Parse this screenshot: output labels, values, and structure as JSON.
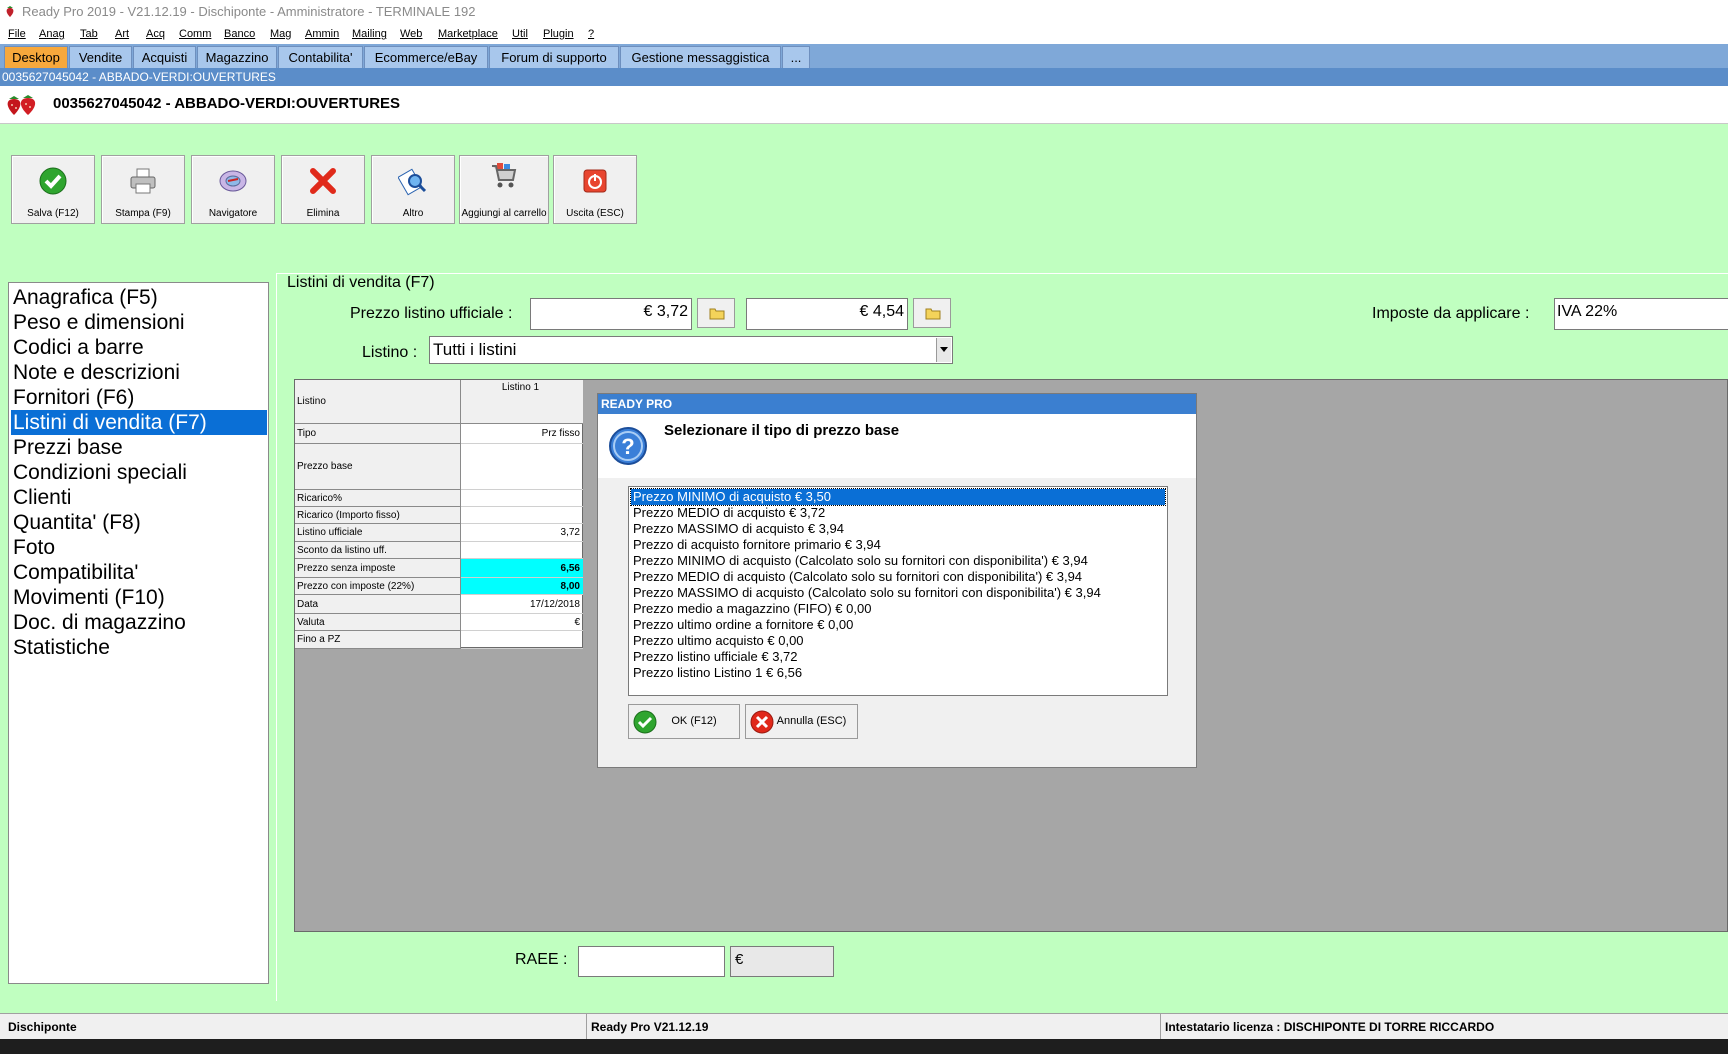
{
  "window": {
    "title": "Ready Pro 2019 - V21.12.19 - Dischiponte - Amministratore - TERMINALE 192"
  },
  "menu": [
    "File",
    "Anag",
    "Tab",
    "Art",
    "Acq",
    "Comm",
    "Banco",
    "Mag",
    "Ammin",
    "Mailing",
    "Web",
    "Marketplace",
    "Util",
    "Plugin",
    "?"
  ],
  "tabs": [
    {
      "label": "Desktop",
      "active": true
    },
    {
      "label": "Vendite"
    },
    {
      "label": "Acquisti"
    },
    {
      "label": "Magazzino"
    },
    {
      "label": "Contabilita'"
    },
    {
      "label": "Ecommerce/eBay"
    },
    {
      "label": "Forum di supporto"
    },
    {
      "label": "Gestione messaggistica"
    },
    {
      "label": "..."
    }
  ],
  "header": {
    "subtitle": "0035627045042 - ABBADO-VERDI:OUVERTURES",
    "title": "0035627045042 - ABBADO-VERDI:OUVERTURES"
  },
  "toolbar": [
    {
      "label": "Salva (F12)",
      "icon": "check-icon"
    },
    {
      "label": "Stampa (F9)",
      "icon": "printer-icon"
    },
    {
      "label": "Navigatore",
      "icon": "navigator-icon"
    },
    {
      "label": "Elimina",
      "icon": "delete-x-icon"
    },
    {
      "label": "Altro",
      "icon": "search-doc-icon"
    },
    {
      "label": "Aggiungi al carrello",
      "icon": "cart-icon"
    },
    {
      "label": "Uscita (ESC)",
      "icon": "power-icon"
    }
  ],
  "nav": {
    "items": [
      "Anagrafica (F5)",
      "Peso e dimensioni",
      "Codici a barre",
      "Note e descrizioni",
      "Fornitori (F6)",
      "Listini di vendita (F7)",
      "Prezzi base",
      "Condizioni speciali",
      "Clienti",
      "Quantita' (F8)",
      "Foto",
      "Compatibilita'",
      "Movimenti (F10)",
      "Doc. di magazzino",
      "Statistiche"
    ],
    "selected_index": 5
  },
  "panel": {
    "group_title": "Listini di vendita (F7)",
    "price_label": "Prezzo listino ufficiale :",
    "price1": "€ 3,72",
    "price2": "€ 4,54",
    "tax_label": "Imposte da applicare :",
    "tax_value": "IVA 22%",
    "listino_label": "Listino :",
    "listino_value": "Tutti i listini",
    "raee_label": "RAEE :",
    "raee_value": "",
    "raee_currency": "€"
  },
  "grid": {
    "header_key": "Listino",
    "header_col": "Listino 1",
    "rows": [
      {
        "k": "Tipo",
        "v": "Prz fisso"
      },
      {
        "k": "Prezzo base",
        "v": ""
      },
      {
        "k": "Ricarico%",
        "v": ""
      },
      {
        "k": "Ricarico (Importo fisso)",
        "v": ""
      },
      {
        "k": "Listino ufficiale",
        "v": "3,72"
      },
      {
        "k": "Sconto da listino uff.",
        "v": ""
      },
      {
        "k": "Prezzo senza imposte",
        "v": "6,56",
        "highlight": true
      },
      {
        "k": "Prezzo con imposte (22%)",
        "v": "8,00",
        "highlight": true
      },
      {
        "k": "Data",
        "v": "17/12/2018"
      },
      {
        "k": "Valuta",
        "v": "€"
      },
      {
        "k": "Fino a PZ",
        "v": ""
      }
    ]
  },
  "dialog": {
    "title": "READY PRO",
    "message": "Selezionare il tipo di prezzo base",
    "options": [
      "Prezzo MINIMO di acquisto € 3,50",
      "Prezzo MEDIO di acquisto € 3,72",
      "Prezzo MASSIMO di acquisto € 3,94",
      "Prezzo di acquisto fornitore primario € 3,94",
      "Prezzo MINIMO di acquisto (Calcolato solo su fornitori con disponibilita') € 3,94",
      "Prezzo MEDIO di acquisto (Calcolato solo su fornitori con disponibilita') € 3,94",
      "Prezzo MASSIMO di acquisto (Calcolato solo su fornitori con disponibilita') € 3,94",
      "Prezzo medio a magazzino (FIFO) € 0,00",
      "Prezzo ultimo ordine a fornitore € 0,00",
      "Prezzo ultimo acquisto € 0,00",
      "Prezzo listino ufficiale € 3,72",
      "Prezzo listino Listino 1 € 6,56"
    ],
    "selected_index": 0,
    "ok_label": "OK (F12)",
    "cancel_label": "Annulla (ESC)"
  },
  "status": {
    "left": "Dischiponte",
    "center": "Ready Pro V21.12.19",
    "right": "Intestatario licenza : DISCHIPONTE DI TORRE RICCARDO"
  },
  "colors": {
    "background": "#c0ffc0",
    "accent": "#0a6fd6",
    "active_tab": "#f7a83c",
    "highlight_cell": "#00ffff"
  }
}
